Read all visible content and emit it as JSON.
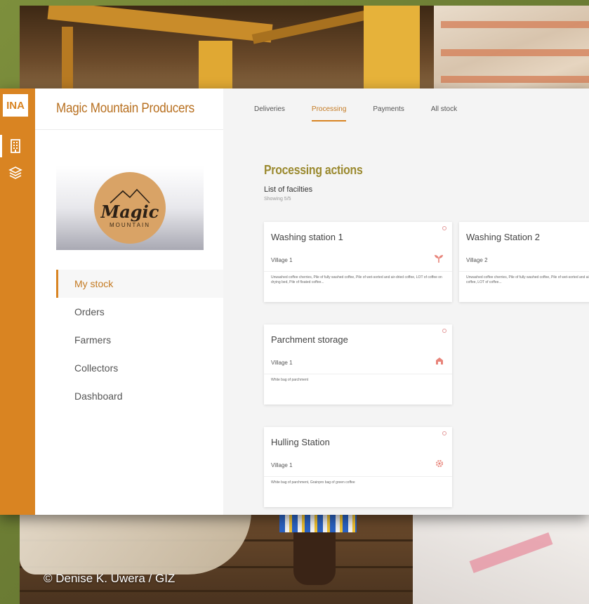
{
  "photo_credit": "©  Denise K. Uwera / GIZ",
  "app": {
    "rail": {
      "logo": "INA",
      "icons": [
        "building-icon",
        "layers-icon"
      ]
    },
    "sidebar": {
      "company": "Magic Mountain Producers",
      "logo": {
        "word": "Magic",
        "sub": "MOUNTAIN"
      },
      "menu": [
        {
          "label": "My stock",
          "active": true
        },
        {
          "label": "Orders"
        },
        {
          "label": "Farmers"
        },
        {
          "label": "Collectors"
        },
        {
          "label": "Dashboard"
        }
      ]
    },
    "tabs": [
      {
        "label": "Deliveries"
      },
      {
        "label": "Processing",
        "active": true
      },
      {
        "label": "Payments"
      },
      {
        "label": "All stock"
      }
    ],
    "section": {
      "title": "Processing actions",
      "subtitle": "List of facilties",
      "count": "Showing 5/5"
    },
    "cards": [
      {
        "title": "Washing station 1",
        "village": "Village 1",
        "icon": "sprout-icon",
        "desc": "Unwashed coffee cherries, Pile of fully washed coffee, Pile of wet-sorted and air-dried coffee, LOT of coffee on drying bed, Pile of floated coffee..."
      },
      {
        "title": "Washing Station 2",
        "village": "Village 2",
        "icon": "sprout-icon",
        "desc": "Unwashed coffee cherries, Pile of fully washed coffee, Pile of wet-sorted and air-dried coffee, Pile of fermented coffee, LOT of coffee..."
      },
      {
        "title": "Parchment storage",
        "village": "Village 1",
        "icon": "warehouse-icon",
        "desc": "White bag of parchment"
      },
      {
        "title": "Hulling Station",
        "village": "Village 1",
        "icon": "gear-icon",
        "desc": "White bag of parchment, Grainpro bag of green coffee"
      }
    ],
    "colors": {
      "accent": "#d98422",
      "title": "#9b8a30",
      "icon": "#e8847a"
    }
  }
}
